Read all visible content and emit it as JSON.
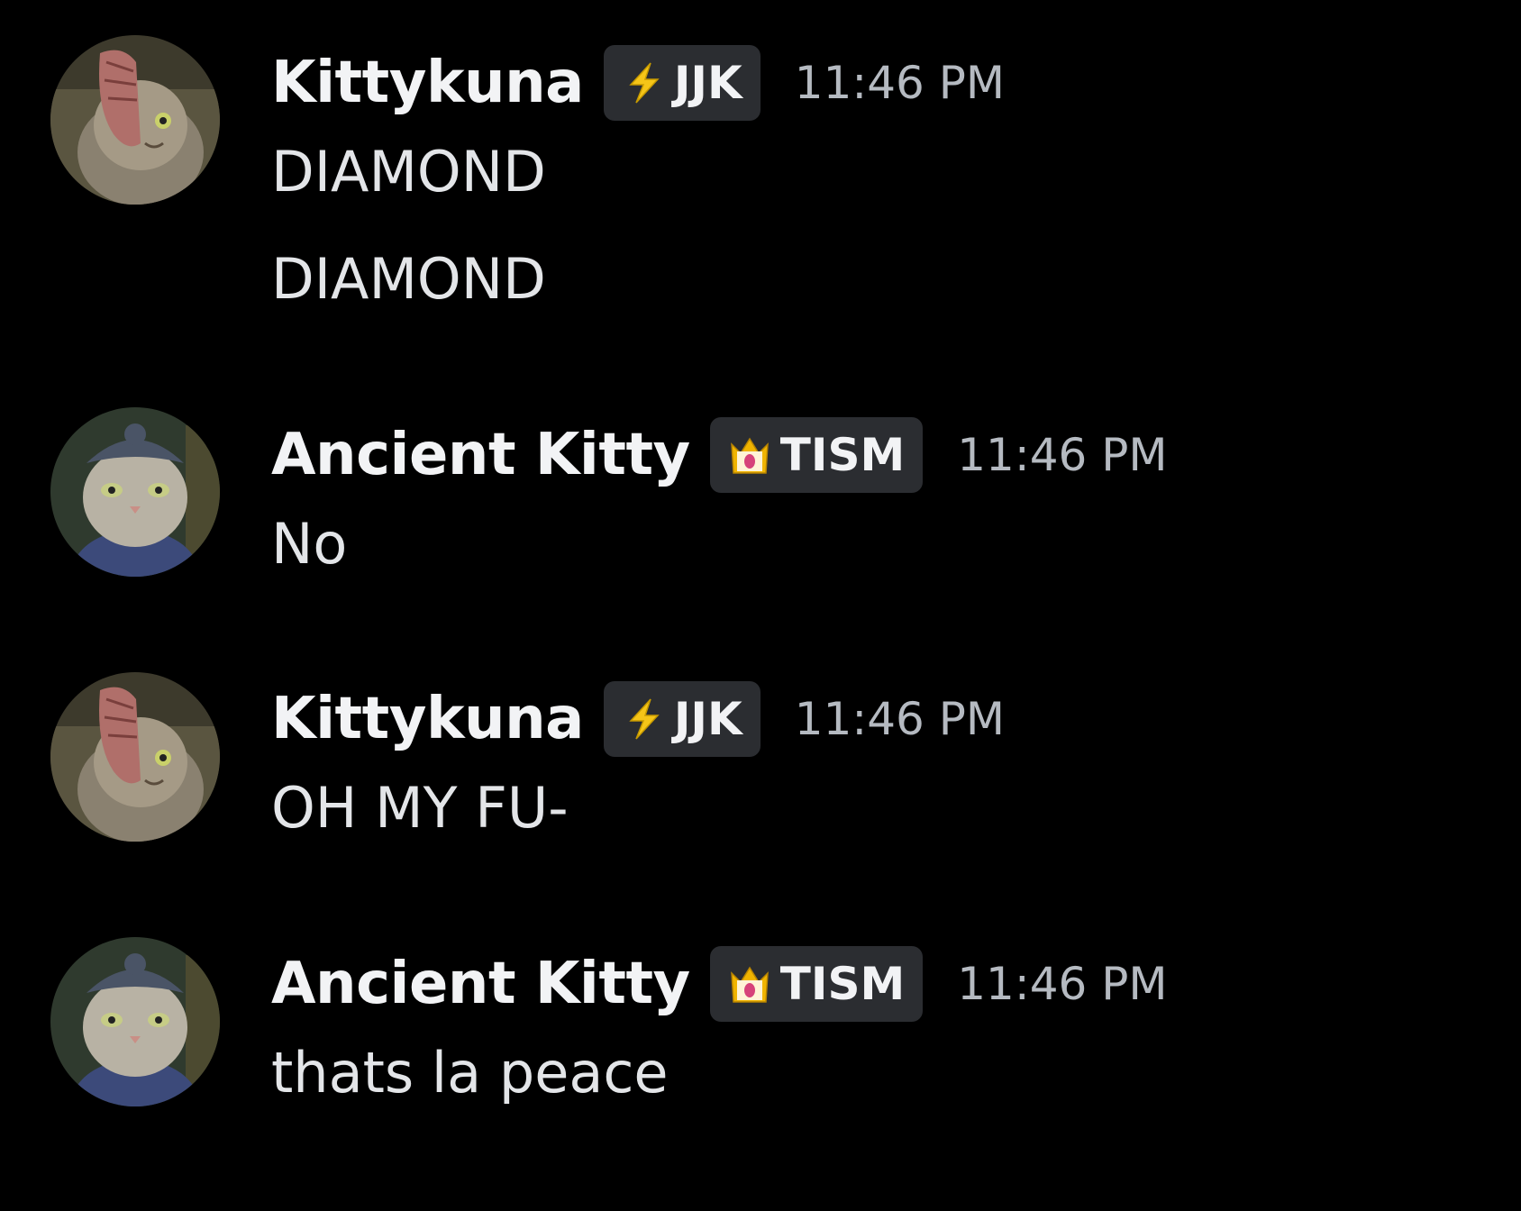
{
  "messages": [
    {
      "username": "Kittykuna",
      "tag": {
        "label": "JJK",
        "icon": "lightning-icon"
      },
      "timestamp": "11:46 PM",
      "lines": [
        "DIAMOND",
        "DIAMOND"
      ]
    },
    {
      "username": "Ancient Kitty",
      "tag": {
        "label": "TISM",
        "icon": "crown-icon"
      },
      "timestamp": "11:46 PM",
      "lines": [
        "No"
      ]
    },
    {
      "username": "Kittykuna",
      "tag": {
        "label": "JJK",
        "icon": "lightning-icon"
      },
      "timestamp": "11:46 PM",
      "lines": [
        "OH MY FU-"
      ]
    },
    {
      "username": "Ancient Kitty",
      "tag": {
        "label": "TISM",
        "icon": "crown-icon"
      },
      "timestamp": "11:46 PM",
      "lines": [
        "thats la peace"
      ]
    }
  ],
  "colors": {
    "background": "#000000",
    "username": "#f2f3f5",
    "message_text": "#e3e5e8",
    "timestamp": "#b5bac1",
    "tag_background": "#2b2d31",
    "lightning": "#f5c518",
    "crown": "#f0b400"
  }
}
